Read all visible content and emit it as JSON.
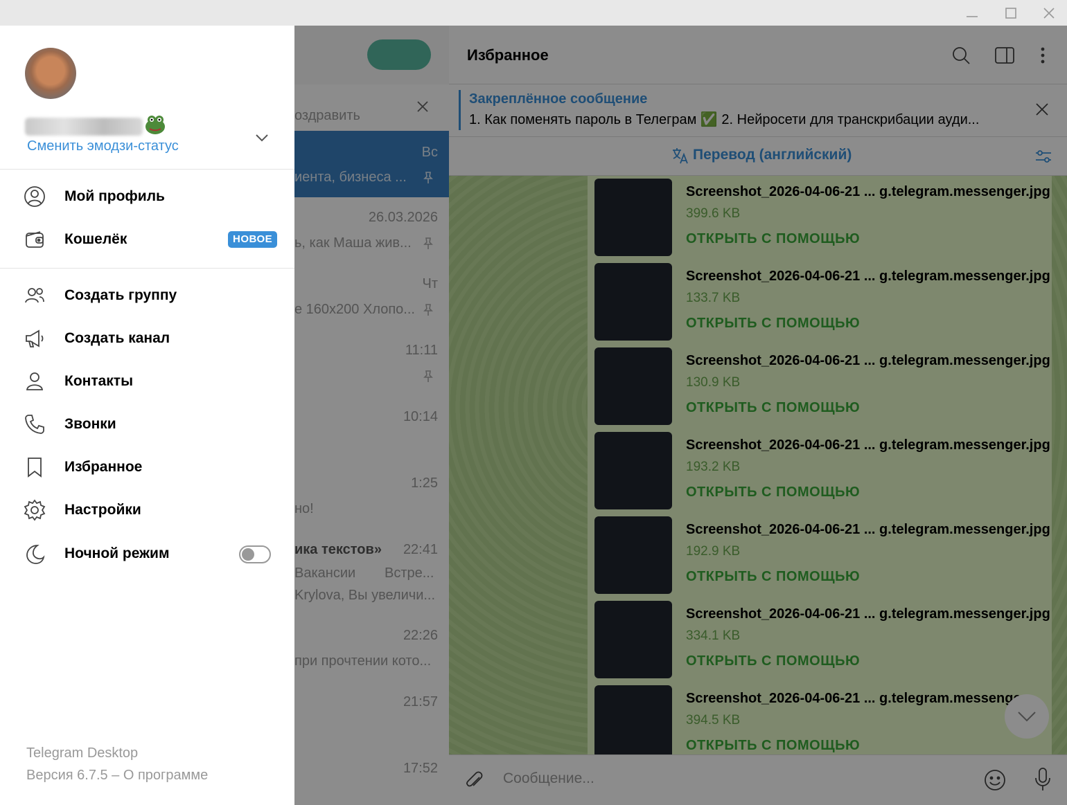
{
  "window": {
    "minimize_icon": "minimize-icon",
    "maximize_icon": "maximize-icon",
    "close_icon": "close-icon"
  },
  "drawer": {
    "change_emoji_status": "Сменить эмодзи-статус",
    "items": [
      {
        "label": "Мой профиль",
        "icon": "profile-icon"
      },
      {
        "label": "Кошелёк",
        "icon": "wallet-icon",
        "badge": "НОВОЕ"
      },
      {
        "label": "Создать группу",
        "icon": "group-icon"
      },
      {
        "label": "Создать канал",
        "icon": "megaphone-icon"
      },
      {
        "label": "Контакты",
        "icon": "contact-icon"
      },
      {
        "label": "Звонки",
        "icon": "phone-icon"
      },
      {
        "label": "Избранное",
        "icon": "bookmark-icon"
      },
      {
        "label": "Настройки",
        "icon": "gear-icon"
      },
      {
        "label": "Ночной режим",
        "icon": "moon-icon",
        "toggle": false
      }
    ],
    "app_name": "Telegram Desktop",
    "version": "Версия 6.7.5 – О программе"
  },
  "chatlist": {
    "items": [
      {
        "snippet": "оздравить",
        "time": ""
      },
      {
        "snippet": "иента, бизнеса ...",
        "time": "Вс"
      },
      {
        "snippet": "ь, как Маша жив...",
        "time": "26.03.2026"
      },
      {
        "snippet": "е 160x200 Хлопо...",
        "time": "Чт"
      },
      {
        "snippet": "",
        "time": "11:11"
      },
      {
        "snippet": "",
        "time": "10:14"
      },
      {
        "snippet": "но!",
        "time": "1:25"
      },
      {
        "snippet": "ика текстов»",
        "time": "22:41"
      },
      {
        "snippet": "Вакансии",
        "time": ""
      },
      {
        "snippet": "Встре...",
        "time": ""
      },
      {
        "snippet": "Krylova, Вы увеличи...",
        "time": ""
      },
      {
        "snippet": "при прочтении кото...",
        "time": "22:26"
      },
      {
        "snippet": "",
        "time": "21:57"
      },
      {
        "snippet": "",
        "time": "17:52"
      }
    ]
  },
  "chat": {
    "title": "Избранное",
    "pinned_title": "Закреплённое сообщение",
    "pinned_text": "1. Как поменять пароль в Телеграм ✅ 2. Нейросети для транскрибации ауди...",
    "translate_label": "Перевод (английский)",
    "open_with": "ОТКРЫТЬ С ПОМОЩЬЮ",
    "files": [
      {
        "name": "Screenshot_2026-04-06-21 ... g.telegram.messenger.jpg",
        "size": "399.6 KB"
      },
      {
        "name": "Screenshot_2026-04-06-21 ... g.telegram.messenger.jpg",
        "size": "133.7 KB"
      },
      {
        "name": "Screenshot_2026-04-06-21 ... g.telegram.messenger.jpg",
        "size": "130.9 KB"
      },
      {
        "name": "Screenshot_2026-04-06-21 ... g.telegram.messenger.jpg",
        "size": "193.2 KB"
      },
      {
        "name": "Screenshot_2026-04-06-21 ... g.telegram.messenger.jpg",
        "size": "192.9 KB"
      },
      {
        "name": "Screenshot_2026-04-06-21 ... g.telegram.messenger.jpg",
        "size": "334.1 KB"
      },
      {
        "name": "Screenshot_2026-04-06-21 ... g.telegram.messenge",
        "size": "394.5 KB"
      }
    ],
    "composer_placeholder": "Сообщение..."
  },
  "colors": {
    "accent": "#3a8fd8",
    "open_green": "#3aa83a",
    "badge_bg": "#3a8fd8"
  }
}
